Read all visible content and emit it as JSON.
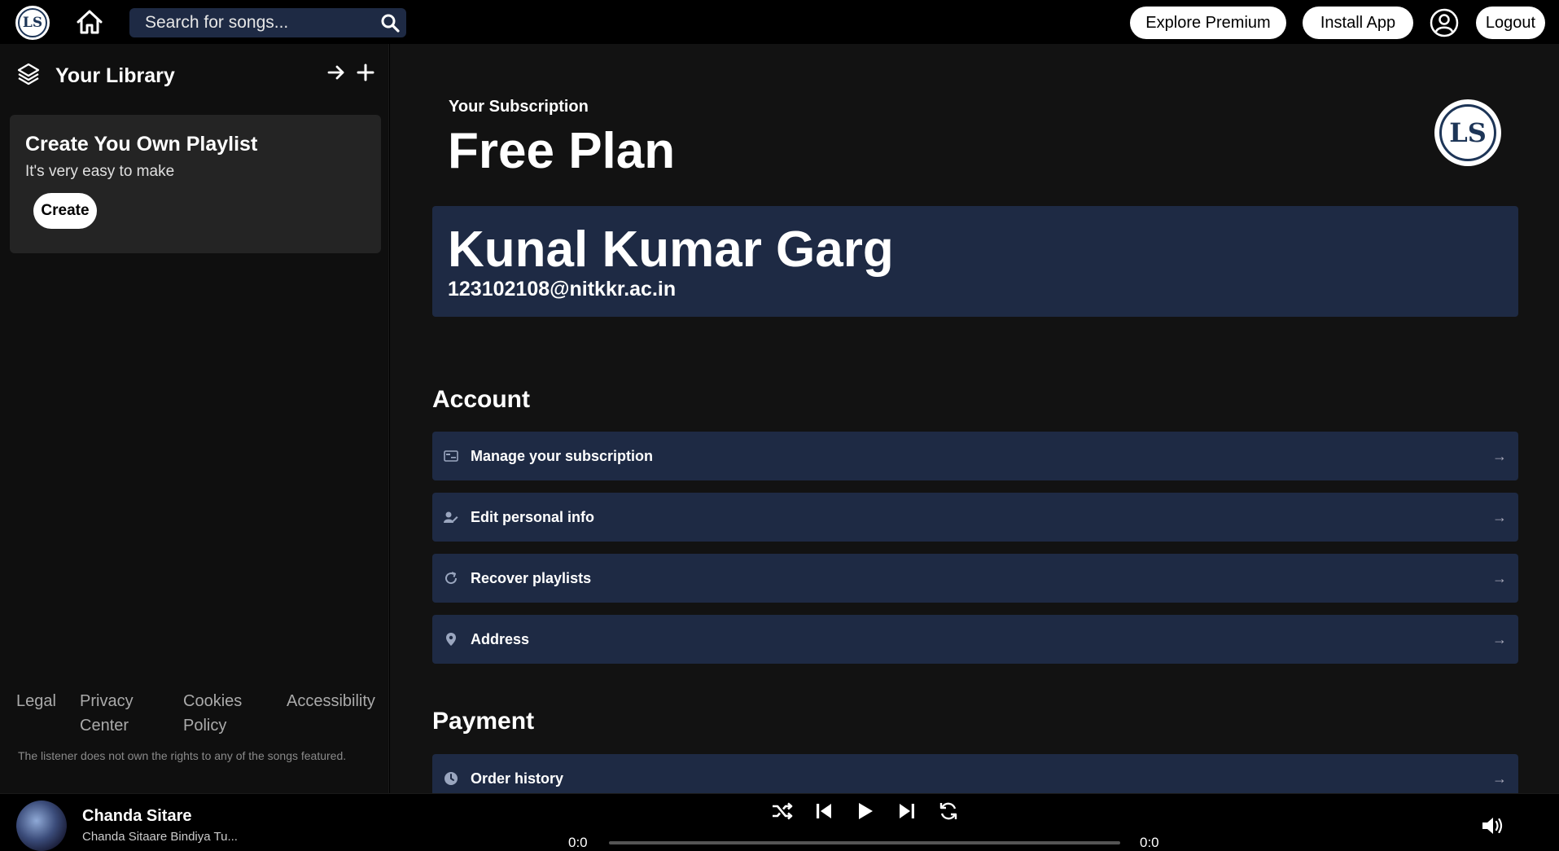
{
  "topbar": {
    "logo_text": "LS",
    "search_placeholder": "Search for songs...",
    "explore_premium": "Explore Premium",
    "install_app": "Install App",
    "logout": "Logout"
  },
  "sidebar": {
    "title": "Your Library",
    "playlist_card": {
      "title": "Create You Own Playlist",
      "subtitle": "It's very easy to make",
      "button": "Create"
    },
    "footer_links": [
      "Legal",
      "Privacy Center",
      "Cookies Policy",
      "Accessibility"
    ],
    "disclaimer": "The listener does not own the rights to any of the songs featured."
  },
  "main": {
    "subscription_label": "Your Subscription",
    "plan_name": "Free Plan",
    "logo_text": "LS",
    "profile": {
      "name": "Kunal Kumar Garg",
      "email": "123102108@nitkkr.ac.in"
    },
    "account": {
      "title": "Account",
      "items": [
        {
          "label": "Manage your subscription",
          "icon": "card-icon"
        },
        {
          "label": "Edit personal info",
          "icon": "user-edit-icon"
        },
        {
          "label": "Recover playlists",
          "icon": "refresh-icon"
        },
        {
          "label": "Address",
          "icon": "location-pin-icon"
        }
      ]
    },
    "payment": {
      "title": "Payment",
      "items": [
        {
          "label": "Order history",
          "icon": "clock-icon"
        }
      ]
    },
    "row_arrow": "→"
  },
  "player": {
    "song_title": "Chanda Sitare",
    "song_subtitle": "Chanda Sitaare Bindiya Tu...",
    "time_current": "0:0",
    "time_total": "0:0",
    "progress": 0
  },
  "colors": {
    "background": "#000000",
    "panel": "#121212",
    "card": "#1e2a44",
    "sidebar_card": "#242424",
    "logo_blue": "#1d3557"
  }
}
